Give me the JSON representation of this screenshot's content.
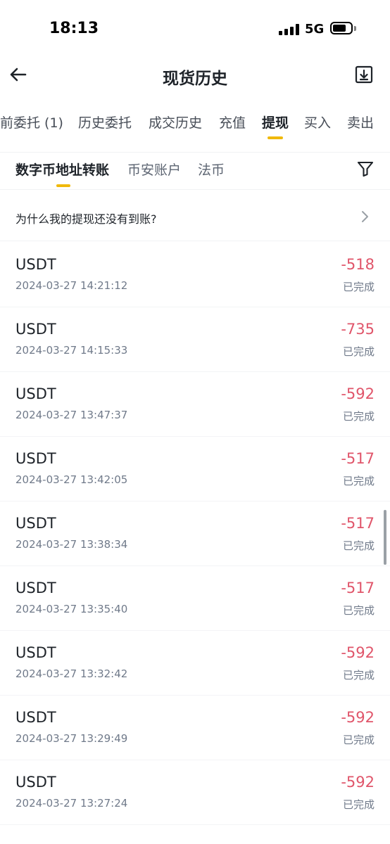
{
  "status_bar": {
    "time": "18:13",
    "network": "5G"
  },
  "header": {
    "title": "现货历史"
  },
  "main_tabs": [
    {
      "label": "前委托 (1)"
    },
    {
      "label": "历史委托"
    },
    {
      "label": "成交历史"
    },
    {
      "label": "充值"
    },
    {
      "label": "提现",
      "active": true
    },
    {
      "label": "买入"
    },
    {
      "label": "卖出"
    }
  ],
  "sub_tabs": [
    {
      "label": "数字币地址转账",
      "active": true
    },
    {
      "label": "币安账户"
    },
    {
      "label": "法币"
    }
  ],
  "notice": {
    "text": "为什么我的提现还没有到账?"
  },
  "colors": {
    "accent": "#f0b90b",
    "negative": "#e0556a",
    "muted": "#707a8a"
  },
  "withdrawals": [
    {
      "coin": "USDT",
      "time": "2024-03-27 14:21:12",
      "amount": "-518",
      "status": "已完成"
    },
    {
      "coin": "USDT",
      "time": "2024-03-27 14:15:33",
      "amount": "-735",
      "status": "已完成"
    },
    {
      "coin": "USDT",
      "time": "2024-03-27 13:47:37",
      "amount": "-592",
      "status": "已完成"
    },
    {
      "coin": "USDT",
      "time": "2024-03-27 13:42:05",
      "amount": "-517",
      "status": "已完成"
    },
    {
      "coin": "USDT",
      "time": "2024-03-27 13:38:34",
      "amount": "-517",
      "status": "已完成"
    },
    {
      "coin": "USDT",
      "time": "2024-03-27 13:35:40",
      "amount": "-517",
      "status": "已完成"
    },
    {
      "coin": "USDT",
      "time": "2024-03-27 13:32:42",
      "amount": "-592",
      "status": "已完成"
    },
    {
      "coin": "USDT",
      "time": "2024-03-27 13:29:49",
      "amount": "-592",
      "status": "已完成"
    },
    {
      "coin": "USDT",
      "time": "2024-03-27 13:27:24",
      "amount": "-592",
      "status": "已完成"
    }
  ]
}
